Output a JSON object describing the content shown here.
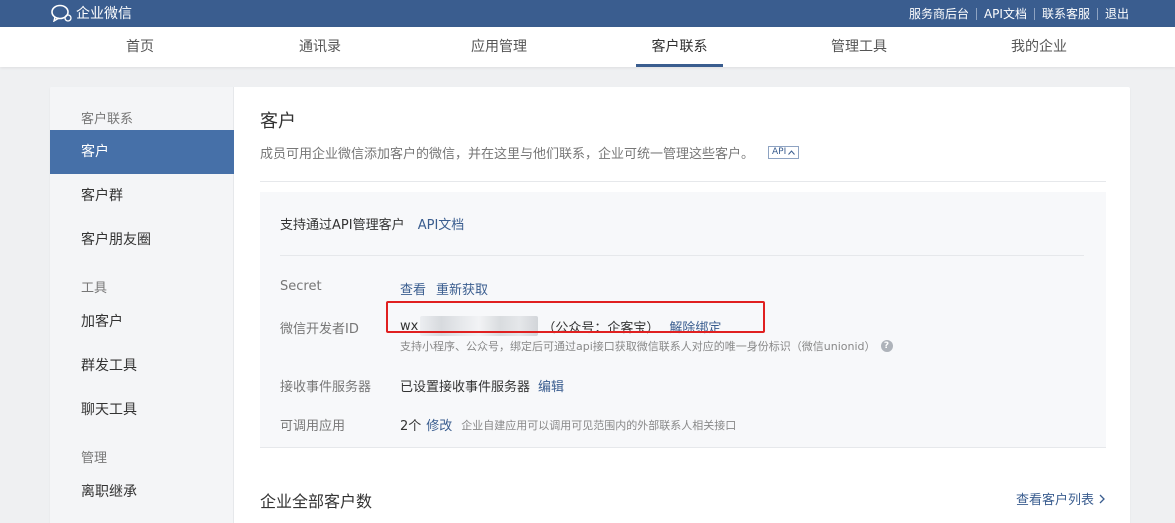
{
  "app": {
    "logo_text": "企业微信",
    "logo_icon": "wecom-bubble-icon"
  },
  "top_links": [
    "服务商后台",
    "API文档",
    "联系客服",
    "退出"
  ],
  "nav": {
    "items": [
      "首页",
      "通讯录",
      "应用管理",
      "客户联系",
      "管理工具",
      "我的企业"
    ],
    "active": "客户联系"
  },
  "sidebar": {
    "group1": "客户联系",
    "customer": "客户",
    "customer_group": "客户群",
    "moments": "客户朋友圈",
    "group2": "工具",
    "add_customer": "加客户",
    "mass_send": "群发工具",
    "chat_tools": "聊天工具",
    "group3": "管理",
    "resign_inherit": "离职继承"
  },
  "main": {
    "title": "客户",
    "description": "成员可用企业微信添加客户的微信，并在这里与他们联系，企业可统一管理这些客户。",
    "api_tag": "API"
  },
  "api_panel": {
    "heading": "支持通过API管理客户",
    "doc_link": "API文档",
    "secret_label": "Secret",
    "secret_view": "查看",
    "secret_refresh": "重新获取",
    "dev_id_label": "微信开发者ID",
    "dev_id_prefix": "wx",
    "dev_id_account": "（公众号：企客宝）",
    "unbind": "解除绑定",
    "dev_id_hint": "支持小程序、公众号，绑定后可通过api接口获取微信联系人对应的唯一身份标识（微信unionid）",
    "event_label": "接收事件服务器",
    "event_value": "已设置接收事件服务器",
    "event_edit": "编辑",
    "apps_label": "可调用应用",
    "apps_count": "2个",
    "apps_modify": "修改",
    "apps_note": "企业自建应用可以调用可见范围内的外部联系人相关接口"
  },
  "section2": {
    "title": "企业全部客户数",
    "view_list": "查看客户列表"
  },
  "colors": {
    "topbar": "#3a5d8f",
    "accent": "#4670a8",
    "highlight_box": "#e02020"
  }
}
